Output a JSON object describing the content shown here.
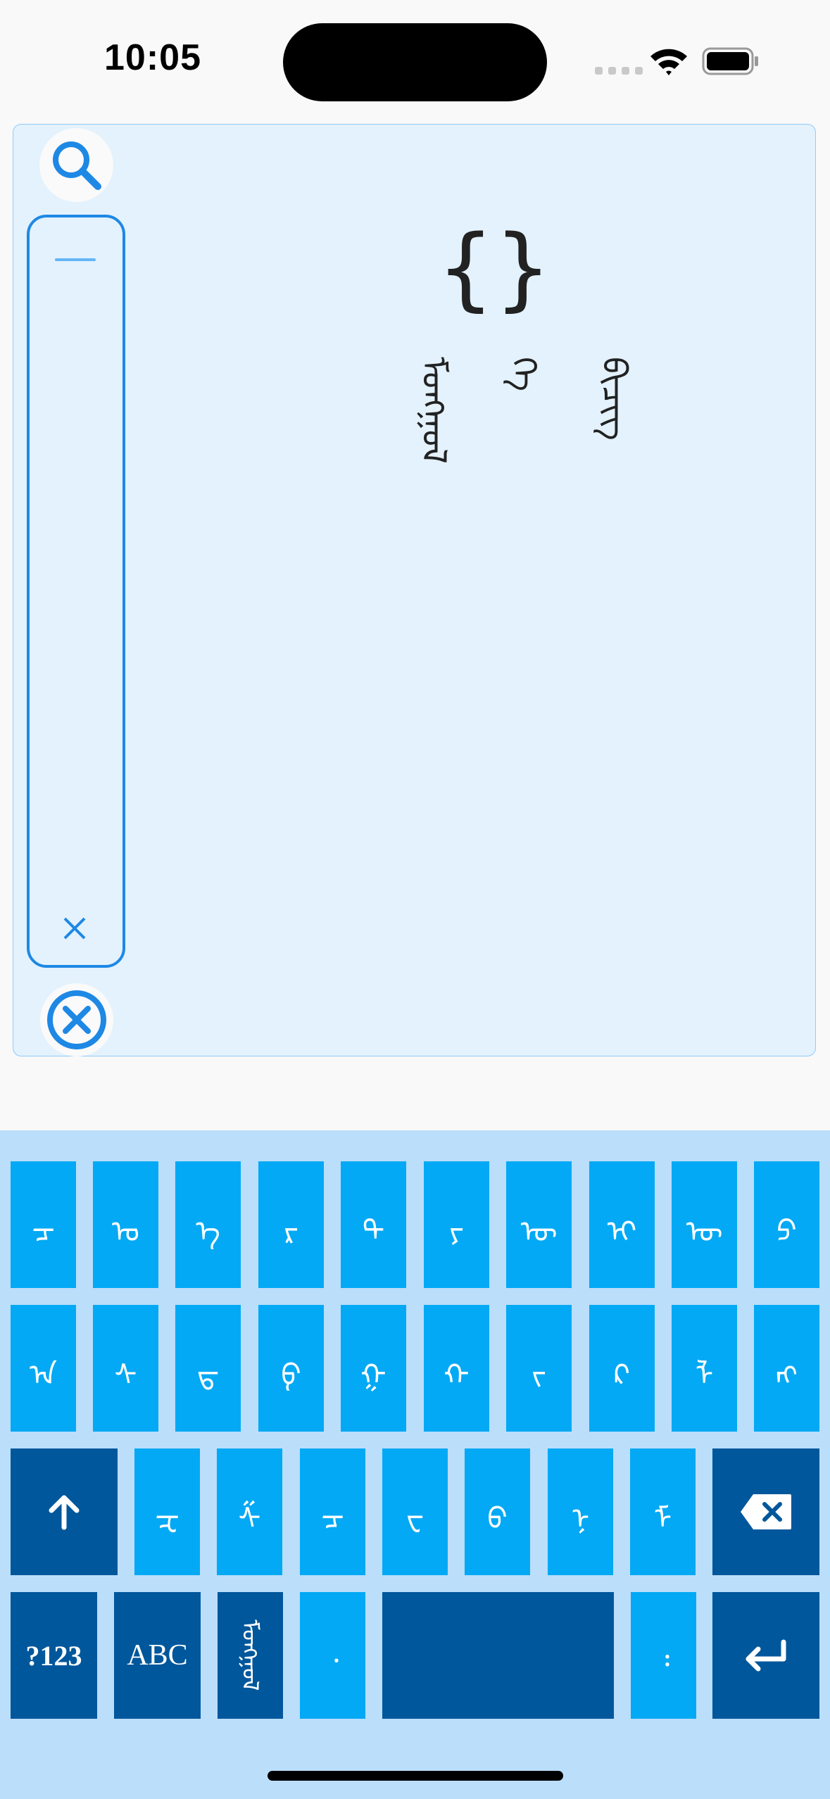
{
  "status_bar": {
    "time": "10:05"
  },
  "editor": {
    "braces_text": "{}",
    "words": [
      "ᠮᠣᠩᠭᠣᠯ",
      "ᠬᠡ",
      "ᠪᠢᠴᠢᠭ"
    ]
  },
  "keyboard": {
    "row1": [
      "ᠴ",
      "ᠣ",
      "ᠡ",
      "ᠷ",
      "ᠲ",
      "ᠶ",
      "ᠦ",
      "ᠢ",
      "ᠥ",
      "ᠫ"
    ],
    "row2": [
      "ᠠ",
      "ᠰ",
      "ᠳ",
      "ᠹ",
      "ᠭ",
      "ᠬ",
      "ᠵ",
      "ᠺ",
      "ᠯ",
      "ᠩ"
    ],
    "row3": [
      "ᠽ",
      "ᠱ",
      "ᠴ",
      "ᠸ",
      "ᠪ",
      "ᠨ",
      "ᠮ"
    ],
    "shift_icon": "shift-arrow-icon",
    "backspace_icon": "backspace-icon",
    "numbers_label": "?123",
    "abc_label": "ABC",
    "mongol_label": "ᠮᠣᠩᠭᠣᠯ",
    "comma_label": "᠂",
    "colon_label": "᠄",
    "return_icon": "return-icon"
  }
}
